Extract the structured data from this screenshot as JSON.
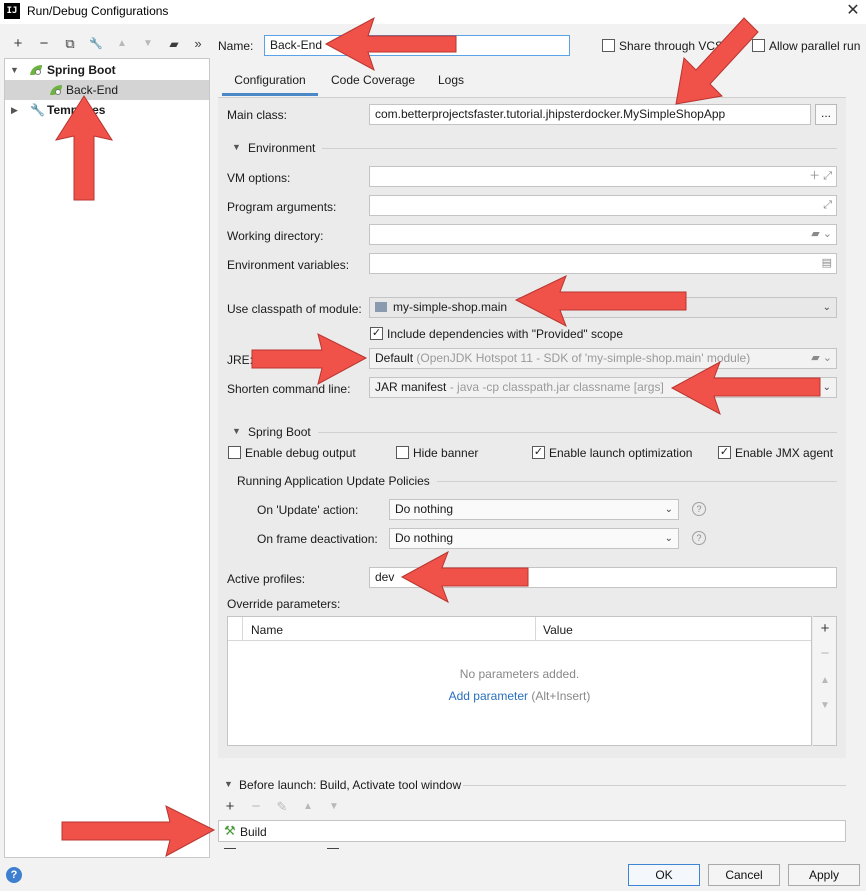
{
  "window": {
    "title": "Run/Debug Configurations",
    "app_icon_text": "IJ",
    "close_glyph": "✕"
  },
  "left_toolbar": {
    "items": [
      {
        "name": "add-button",
        "glyph": "+",
        "disabled": false
      },
      {
        "name": "remove-button",
        "glyph": "−",
        "disabled": false
      },
      {
        "name": "copy-button",
        "glyph": "⧉",
        "disabled": false
      },
      {
        "name": "edit-defaults-button",
        "glyph": "🔧",
        "disabled": false
      },
      {
        "name": "move-up-button",
        "glyph": "▲",
        "disabled": true
      },
      {
        "name": "move-down-button",
        "glyph": "▼",
        "disabled": true
      },
      {
        "name": "folder-button",
        "glyph": "▰",
        "disabled": false
      },
      {
        "name": "more-button",
        "glyph": "»",
        "disabled": false
      }
    ]
  },
  "tree": {
    "spring_boot": "Spring Boot",
    "back_end": "Back-End",
    "templates": "Templates"
  },
  "header": {
    "name_label": "Name:",
    "name_value": "Back-End",
    "share_vcs": "Share through VCS",
    "allow_parallel": "Allow parallel run"
  },
  "tabs": {
    "configuration": "Configuration",
    "code_coverage": "Code Coverage",
    "logs": "Logs"
  },
  "config": {
    "main_class_label": "Main class:",
    "main_class_value": "com.betterprojectsfaster.tutorial.jhipsterdocker.MySimpleShopApp",
    "browse_label": "...",
    "environment_title": "Environment",
    "vm_options_label": "VM options:",
    "program_args_label": "Program arguments:",
    "working_dir_label": "Working directory:",
    "env_vars_label": "Environment variables:",
    "classpath_label": "Use classpath of module:",
    "classpath_value": "my-simple-shop.main",
    "include_deps_label": "Include dependencies with \"Provided\" scope",
    "jre_label": "JRE:",
    "jre_value_bold": "Default",
    "jre_value_hint": "(OpenJDK Hotspot 11 - SDK of 'my-simple-shop.main' module)",
    "shorten_label": "Shorten command line:",
    "shorten_value_bold": "JAR manifest",
    "shorten_value_hint": "- java -cp classpath.jar classname [args]"
  },
  "spring_boot": {
    "title": "Spring Boot",
    "debug_output": "Enable debug output",
    "hide_banner": "Hide banner",
    "launch_opt": "Enable launch optimization",
    "jmx_agent": "Enable JMX agent",
    "update_policies_title": "Running Application Update Policies",
    "on_update_label": "On 'Update' action:",
    "on_update_value": "Do nothing",
    "on_frame_label": "On frame deactivation:",
    "on_frame_value": "Do nothing",
    "active_profiles_label": "Active profiles:",
    "active_profiles_value": "dev",
    "override_label": "Override parameters:"
  },
  "params_table": {
    "col_name": "Name",
    "col_value": "Value",
    "empty_text": "No parameters added.",
    "add_link": "Add parameter",
    "add_hint": "(Alt+Insert)"
  },
  "before_launch": {
    "title": "Before launch: Build, Activate tool window",
    "item": "Build"
  },
  "buttons": {
    "help": "?",
    "ok": "OK",
    "cancel": "Cancel",
    "apply": "Apply"
  },
  "colors": {
    "accent": "#4a88c7",
    "link": "#2a6fbf",
    "annotation_arrow": "#f0524a",
    "spring_green": "#6db33f"
  }
}
